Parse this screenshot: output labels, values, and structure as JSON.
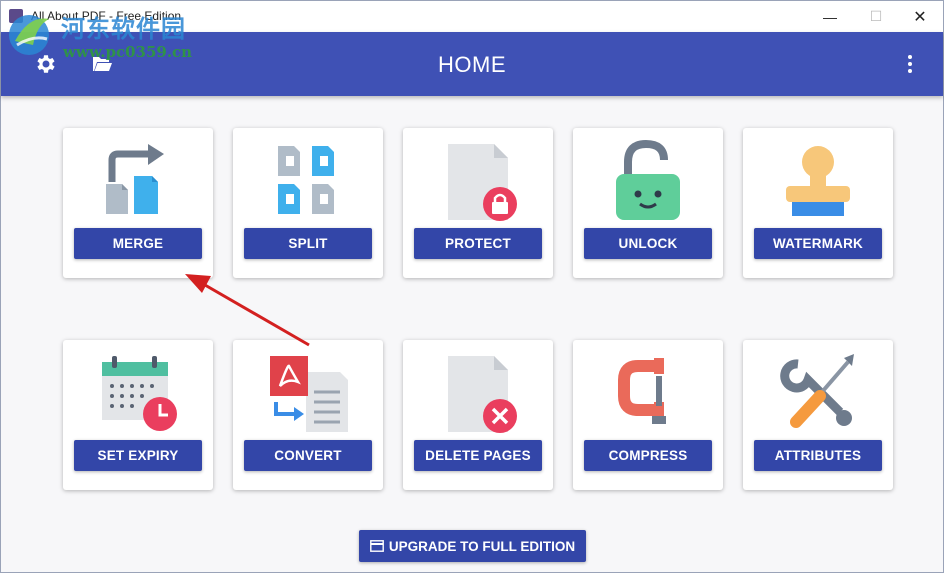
{
  "window": {
    "title": "All About PDF - Free Edition",
    "min": "—",
    "max": "☐",
    "close": "✕"
  },
  "watermark": {
    "cn_text": "河东软件园",
    "url": "www.pc0359.cn"
  },
  "appbar": {
    "title": "HOME",
    "icons": [
      "gear-icon",
      "folder-open-icon",
      "more-vertical-icon"
    ]
  },
  "tools": [
    {
      "label": "MERGE",
      "icon": "merge-icon"
    },
    {
      "label": "SPLIT",
      "icon": "split-icon"
    },
    {
      "label": "PROTECT",
      "icon": "protect-icon"
    },
    {
      "label": "UNLOCK",
      "icon": "unlock-icon"
    },
    {
      "label": "WATERMARK",
      "icon": "stamp-icon"
    },
    {
      "label": "SET EXPIRY",
      "icon": "calendar-clock-icon"
    },
    {
      "label": "CONVERT",
      "icon": "pdf-convert-icon"
    },
    {
      "label": "DELETE PAGES",
      "icon": "delete-page-icon"
    },
    {
      "label": "COMPRESS",
      "icon": "clamp-icon"
    },
    {
      "label": "ATTRIBUTES",
      "icon": "tools-icon"
    }
  ],
  "upgrade": {
    "label": "UPGRADE TO FULL EDITION",
    "icon": "card-icon"
  },
  "colors": {
    "appbar": "#3f51b5",
    "button": "#3346a8",
    "annotation_arrow": "#d32020"
  }
}
